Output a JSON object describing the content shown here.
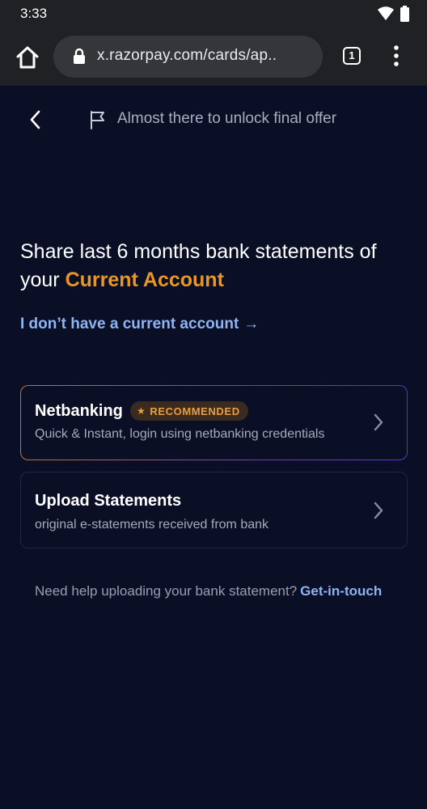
{
  "status_bar": {
    "time": "3:33"
  },
  "browser": {
    "url": "x.razorpay.com/cards/ap..",
    "tab_count": "1"
  },
  "header": {
    "progress_text": "Almost there to unlock final offer"
  },
  "headline": {
    "text": "Share last 6 months bank statements of your",
    "accent": "Current Account"
  },
  "no_account_link": {
    "label": "I don’t have a current account",
    "arrow": "→"
  },
  "options": [
    {
      "title": "Netbanking",
      "badge": "RECOMMENDED",
      "subtitle": "Quick & Instant, login using netbanking credentials"
    },
    {
      "title": "Upload Statements",
      "subtitle": "original e-statements received from bank"
    }
  ],
  "help": {
    "text": "Need help uploading your bank statement?",
    "link": "Get-in-touch"
  },
  "colors": {
    "background": "#0a0f26",
    "accent_orange": "#e89625",
    "link_blue": "#8db4f5"
  }
}
